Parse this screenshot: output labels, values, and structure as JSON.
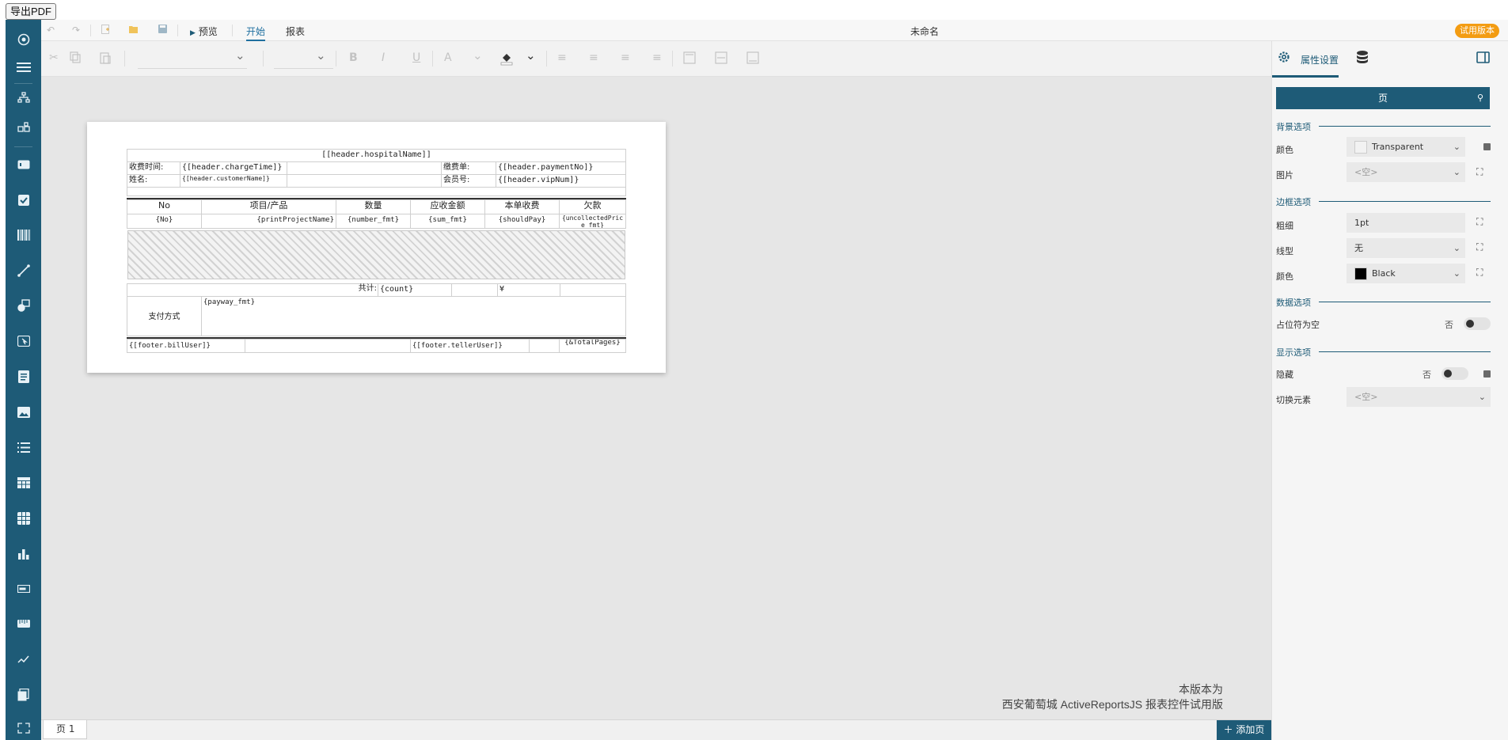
{
  "export_button": "导出PDF",
  "topbar": {
    "preview_label": "预览",
    "tabs": [
      "开始",
      "报表"
    ],
    "doc_title": "未命名",
    "trial_badge": "试用版本"
  },
  "report": {
    "hospital_name": "[[header.hospitalName]]",
    "charge_time_label": "收费时间:",
    "charge_time_value": "{[header.chargeTime]}",
    "payment_no_label": "缴费单:",
    "payment_no_value": "{[header.paymentNo]}",
    "name_label": "姓名:",
    "name_value": "{[header.customerName]}",
    "vip_label": "会员号:",
    "vip_value": "{[header.vipNum]}",
    "columns": [
      "No",
      "项目/产品",
      "数量",
      "应收金额",
      "本单收费",
      "欠款"
    ],
    "row_fields": [
      "{No}",
      "{printProjectName}",
      "{number_fmt}",
      "{sum_fmt}",
      "{shouldPay}",
      "{uncollectedPrice_fmt}"
    ],
    "total_label": "共计:",
    "total_count": "{count}",
    "currency": "¥",
    "payway_label": "支付方式",
    "payway_value": "{payway_fmt}",
    "footer_bill_user": "{[footer.billUser]}",
    "footer_teller_user": "{[footer.tellerUser]}",
    "footer_total_pages": "{&TotalPages}"
  },
  "watermark": {
    "line1": "本版本为",
    "line2": "西安葡萄城 ActiveReportsJS 报表控件试用版"
  },
  "bottombar": {
    "page_tab": "页 1",
    "add_page": "添加页"
  },
  "right_panel": {
    "tab_properties": "属性设置",
    "header": "页",
    "sections": {
      "background": "背景选项",
      "border": "边框选项",
      "data": "数据选项",
      "display": "显示选项"
    },
    "fields": {
      "bg_color_label": "颜色",
      "bg_color_value": "Transparent",
      "image_label": "图片",
      "image_value": "<空>",
      "border_width_label": "粗细",
      "border_width_value": "1pt",
      "border_style_label": "线型",
      "border_style_value": "无",
      "border_color_label": "颜色",
      "border_color_value": "Black",
      "placeholder_label": "占位符为空",
      "placeholder_value": "否",
      "hidden_label": "隐藏",
      "hidden_value": "否",
      "toggle_label": "切换元素",
      "toggle_value": "<空>"
    }
  }
}
